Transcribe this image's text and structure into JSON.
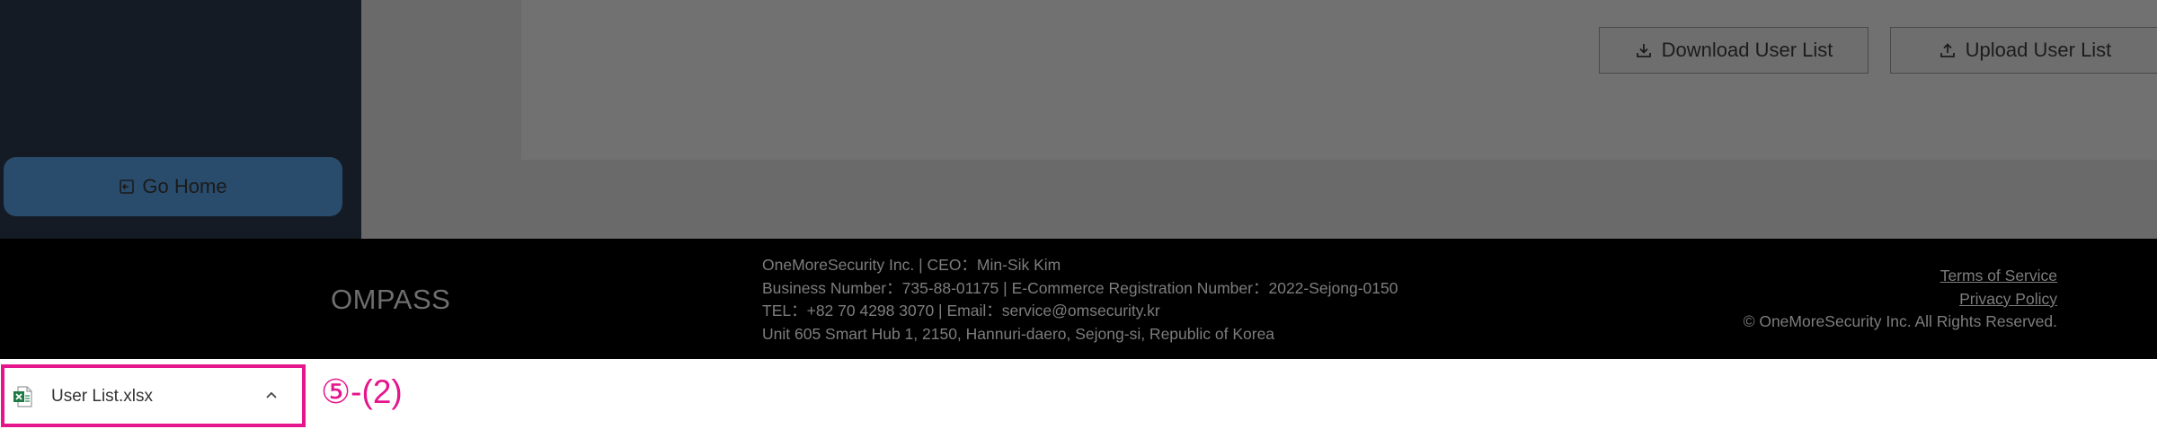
{
  "sidebar": {
    "go_home_label": "Go Home"
  },
  "main": {
    "download_label": "Download User List",
    "upload_label": "Upload User List"
  },
  "footer": {
    "logo": "OMPASS",
    "info": [
      "OneMoreSecurity Inc. | CEO：Min-Sik Kim",
      "Business Number：735-88-01175 | E-Commerce Registration Number：2022-Sejong-0150",
      "TEL：+82 70 4298 3070 | Email：service@omsecurity.kr",
      "Unit 605 Smart Hub 1, 2150, Hannuri-daero, Sejong-si, Republic of Korea"
    ],
    "terms_label": "Terms of Service",
    "privacy_label": "Privacy Policy",
    "copyright": "© OneMoreSecurity Inc. All Rights Reserved."
  },
  "download_bar": {
    "file_name": "User List.xlsx",
    "file_icon": "excel-file-icon",
    "step_label": "⑤-(2)"
  },
  "colors": {
    "highlight": "#e5158c",
    "sidebar_bg": "#141b24",
    "go_home_bg": "#2a4c6c",
    "footer_bg": "#000000"
  }
}
